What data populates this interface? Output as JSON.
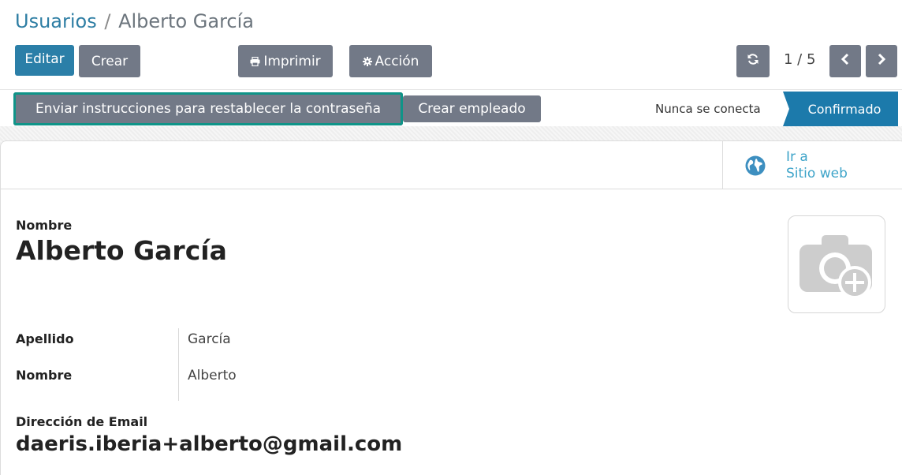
{
  "breadcrumb": {
    "parent": "Usuarios",
    "separator": "/",
    "current": "Alberto García"
  },
  "toolbar": {
    "edit_label": "Editar",
    "create_label": "Crear",
    "print_label": "Imprimir",
    "print_icon": "printer-icon",
    "action_label": "Acción",
    "action_icon": "gear-icon"
  },
  "pager": {
    "value": "1 / 5"
  },
  "statusbar": {
    "reset_password_label": "Enviar instrucciones para restablecer la contraseña",
    "create_employee_label": "Crear empleado",
    "stages": [
      "Nunca se conecta",
      "Confirmado"
    ],
    "active_stage": "Confirmado"
  },
  "smart_button": {
    "line1": "Ir a",
    "line2": "Sitio web",
    "icon": "globe-icon"
  },
  "form": {
    "name_label": "Nombre",
    "name_value": "Alberto García",
    "surname_label": "Apellido",
    "surname_value": "García",
    "firstname_label": "Nombre",
    "firstname_value": "Alberto",
    "email_label": "Dirección de Email",
    "email_value": "daeris.iberia+alberto@gmail.com"
  },
  "colors": {
    "primary": "#2b7fa8",
    "secondary": "#727987",
    "highlight": "#0f9488",
    "link": "#2e7ea4",
    "stage_active": "#1c7aab"
  }
}
